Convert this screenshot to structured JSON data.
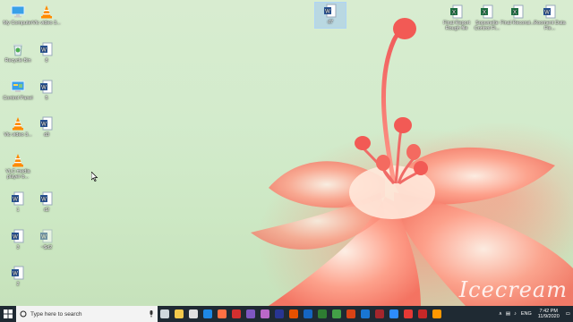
{
  "desktop": {
    "left_icons": [
      {
        "label": "My Computer",
        "icon": "monitor-icon"
      },
      {
        "label": "Vlc video 3...",
        "icon": "vlc-icon"
      },
      {
        "label": "Recycle Bin",
        "icon": "recycle-bin-icon"
      },
      {
        "label": "8",
        "icon": "word-doc-icon"
      },
      {
        "label": "Control Panel",
        "icon": "control-panel-icon"
      },
      {
        "label": "5",
        "icon": "word-doc-icon"
      },
      {
        "label": "Vlc video 3...",
        "icon": "vlc-icon"
      },
      {
        "label": "d3",
        "icon": "word-doc-icon"
      },
      {
        "label": "VLC media player b...",
        "icon": "vlc-icon"
      },
      {
        "label": "1",
        "icon": "word-doc-icon"
      },
      {
        "label": "d2",
        "icon": "word-doc-icon"
      },
      {
        "label": "3",
        "icon": "word-doc-icon"
      },
      {
        "label": "~$d2",
        "icon": "word-doc-faded-icon"
      },
      {
        "label": "2",
        "icon": "word-doc-icon"
      }
    ],
    "selected_icon": {
      "label": "d7",
      "icon": "word-doc-icon"
    },
    "right_icons": [
      {
        "label": "Final Report Rough file",
        "icon": "excel-icon"
      },
      {
        "label": "Sopwnelte Control Fi...",
        "icon": "excel-icon"
      },
      {
        "label": "Final Reconsi...",
        "icon": "excel-icon"
      },
      {
        "label": "Rooment Data Fie...",
        "icon": "word-doc-icon"
      }
    ],
    "watermark": "Icecream"
  },
  "taskbar": {
    "search_placeholder": "Type here to search",
    "apps": [
      {
        "name": "task-view",
        "color": "#cfd8dc"
      },
      {
        "name": "file-explorer",
        "color": "#f2c94c"
      },
      {
        "name": "store",
        "color": "#e0e0e0"
      },
      {
        "name": "edge",
        "color": "#1e88e5"
      },
      {
        "name": "firefox",
        "color": "#ff7043"
      },
      {
        "name": "opera",
        "color": "#d32f2f"
      },
      {
        "name": "viber",
        "color": "#7e57c2"
      },
      {
        "name": "photos",
        "color": "#ba68c8"
      },
      {
        "name": "premiere",
        "color": "#283593"
      },
      {
        "name": "illustrator",
        "color": "#e65100"
      },
      {
        "name": "word",
        "color": "#1565c0"
      },
      {
        "name": "excel",
        "color": "#2e7d32"
      },
      {
        "name": "chrome",
        "color": "#43a047"
      },
      {
        "name": "powerpoint",
        "color": "#d84315"
      },
      {
        "name": "outlook",
        "color": "#1976d2"
      },
      {
        "name": "access",
        "color": "#a4262c"
      },
      {
        "name": "zoom",
        "color": "#2d8cff"
      },
      {
        "name": "opera-gx",
        "color": "#e53935"
      },
      {
        "name": "vpn",
        "color": "#c62828"
      },
      {
        "name": "vlc",
        "color": "#ff9800"
      }
    ],
    "tray": {
      "language": "ENG",
      "time": "7:42 PM",
      "date": "11/9/2020"
    }
  }
}
